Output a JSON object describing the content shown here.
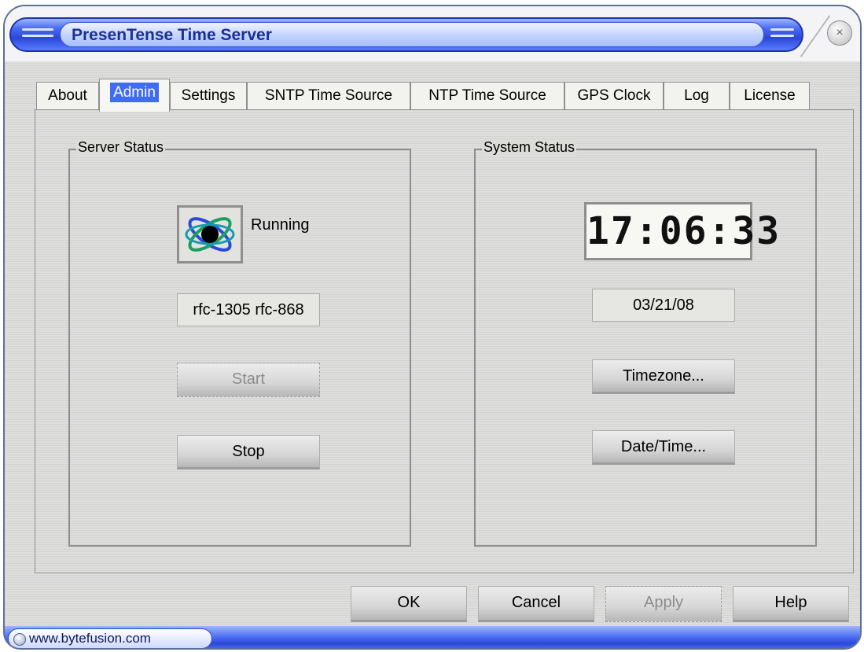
{
  "window": {
    "title": "PresenTense Time Server",
    "close_symbol": "×"
  },
  "tabs": [
    {
      "label": "About",
      "active": false
    },
    {
      "label": "Admin",
      "active": true
    },
    {
      "label": "Settings",
      "active": false
    },
    {
      "label": "SNTP Time Source",
      "active": false
    },
    {
      "label": "NTP Time Source",
      "active": false
    },
    {
      "label": "GPS Clock",
      "active": false
    },
    {
      "label": "Log",
      "active": false
    },
    {
      "label": "License",
      "active": false
    }
  ],
  "server_status": {
    "group_label": "Server Status",
    "state_text": "Running",
    "protocols": "rfc-1305 rfc-868",
    "start_label": "Start",
    "stop_label": "Stop"
  },
  "system_status": {
    "group_label": "System Status",
    "time": "17:06:33",
    "date": "03/21/08",
    "timezone_label": "Timezone...",
    "datetime_label": "Date/Time..."
  },
  "footer": {
    "ok_label": "OK",
    "cancel_label": "Cancel",
    "apply_label": "Apply",
    "help_label": "Help"
  },
  "statusbar": {
    "url": "www.bytefusion.com"
  },
  "colors": {
    "title_bar": "#4a6bf2",
    "active_tab": "#3f6cf2",
    "panel_bg": "#dcdcd8"
  }
}
